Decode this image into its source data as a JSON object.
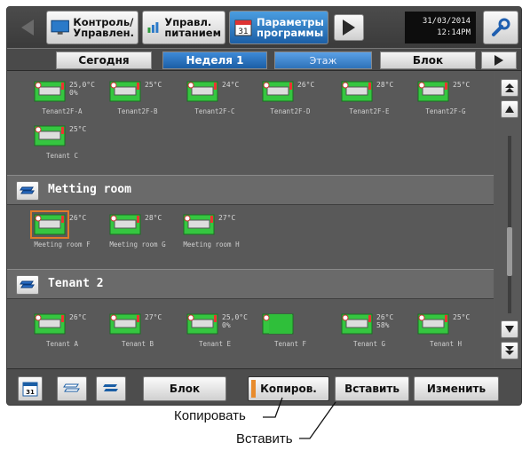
{
  "header": {
    "buttons": [
      {
        "label": "Контроль/\nУправлен.",
        "icon": "monitor-icon"
      },
      {
        "label": "Управл.\nпитанием",
        "icon": "energy-bars-icon"
      },
      {
        "label": "Параметры\nпрограммы",
        "icon": "calendar-icon"
      }
    ],
    "date": "31/03/2014",
    "time": "12:14PM"
  },
  "tabs": [
    "Сегодня",
    "Неделя 1",
    "Этаж",
    "Блок"
  ],
  "groups": [
    {
      "name": "",
      "units": [
        {
          "temp": "25,0°C\n0%",
          "name": "Tenant2F-A"
        },
        {
          "temp": "25°C",
          "name": "Tenant2F-B"
        },
        {
          "temp": "24°C",
          "name": "Tenant2F-C"
        },
        {
          "temp": "26°C",
          "name": "Tenant2F-D"
        },
        {
          "temp": "28°C",
          "name": "Tenant2F-E"
        },
        {
          "temp": "25°C",
          "name": "Tenant2F-G"
        },
        {
          "temp": "25°C",
          "name": "Tenant C"
        }
      ]
    },
    {
      "name": "Metting room",
      "units": [
        {
          "temp": "26°C",
          "name": "Meeting room F"
        },
        {
          "temp": "28°C",
          "name": "Meeting room G"
        },
        {
          "temp": "27°C",
          "name": "Meeting room H"
        }
      ]
    },
    {
      "name": "Tenant 2",
      "units": [
        {
          "temp": "26°C",
          "name": "Tenant A"
        },
        {
          "temp": "27°C",
          "name": "Tenant B"
        },
        {
          "temp": "25,0°C\n0%",
          "name": "Tenant E"
        },
        {
          "temp": "",
          "name": "Tenant F"
        },
        {
          "temp": "26°C\n58%",
          "name": "Tenant G"
        },
        {
          "temp": "25°C",
          "name": "Tenant H"
        }
      ]
    }
  ],
  "toolbar": {
    "block_label": "Блок",
    "copy_label": "Копиров.",
    "paste_label": "Вставить",
    "edit_label": "Изменить"
  },
  "annotations": {
    "copy": "Копировать",
    "paste": "Вставить"
  },
  "colors": {
    "accent_blue": "#1c5fa6",
    "selected_orange": "#e07a2a",
    "unit_green": "#2fbf3a"
  }
}
